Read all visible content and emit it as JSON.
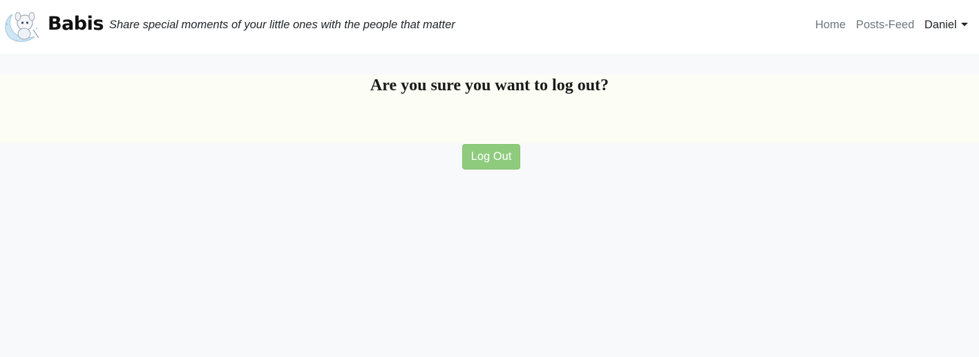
{
  "navbar": {
    "brand_name": "Babis",
    "tagline": "Share special moments of your little ones with the people that matter",
    "logo_icon": "baby-moon-logo",
    "links": [
      {
        "label": "Home"
      },
      {
        "label": "Posts-Feed"
      }
    ],
    "user_menu": {
      "label": "Daniel",
      "icon": "caret-down-icon"
    }
  },
  "main": {
    "question": "Are you sure you want to log out?",
    "logout_button_label": "Log Out"
  },
  "colors": {
    "page_background": "#f8f9fb",
    "navbar_background": "#ffffff",
    "band_background": "#fcfdf4",
    "button_background": "#8fcb7d",
    "link_muted": "#6c757d",
    "text_dark": "#212529"
  }
}
